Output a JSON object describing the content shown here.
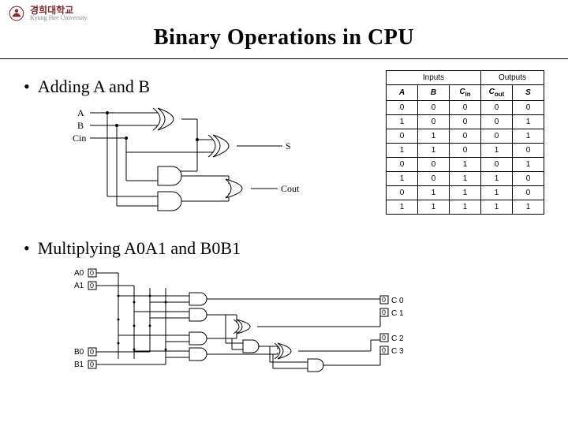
{
  "header": {
    "univ_ko": "경희대학교",
    "univ_en": "Kyung Hee University"
  },
  "title": "Binary Operations in CPU",
  "bullets": {
    "adder": "Adding A and B",
    "mult": "Multiplying A0A1 and B0B1"
  },
  "adder_labels": {
    "A": "A",
    "B": "B",
    "Cin": "Cin",
    "S": "S",
    "Cout": "Cout"
  },
  "mult_labels": {
    "A0": "A0",
    "A1": "A1",
    "B0": "B0",
    "B1": "B1",
    "C0": "C 0",
    "C1": "C 1",
    "C2": "C 2",
    "C3": "C 3",
    "zero": "0"
  },
  "table": {
    "group_inputs": "Inputs",
    "group_outputs": "Outputs",
    "columns": [
      "A",
      "B",
      "Cin",
      "Cout",
      "S"
    ],
    "col_sub": [
      "",
      "",
      "in",
      "out",
      ""
    ],
    "col_base": [
      "A",
      "B",
      "C",
      "C",
      "S"
    ],
    "rows": [
      [
        0,
        0,
        0,
        0,
        0
      ],
      [
        1,
        0,
        0,
        0,
        1
      ],
      [
        0,
        1,
        0,
        0,
        1
      ],
      [
        1,
        1,
        0,
        1,
        0
      ],
      [
        0,
        0,
        1,
        0,
        1
      ],
      [
        1,
        0,
        1,
        1,
        0
      ],
      [
        0,
        1,
        1,
        1,
        0
      ],
      [
        1,
        1,
        1,
        1,
        1
      ]
    ]
  }
}
